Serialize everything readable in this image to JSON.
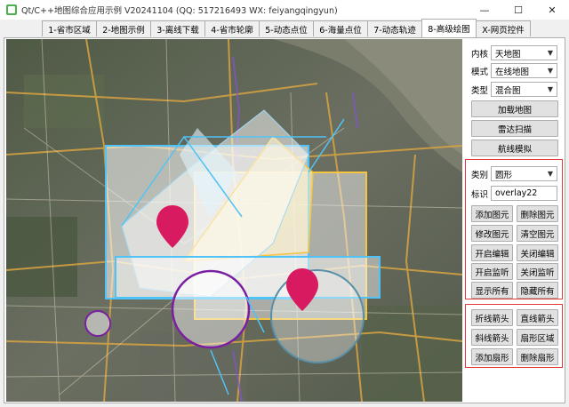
{
  "window": {
    "title": "Qt/C++地图综合应用示例 V20241104 (QQ: 517216493 WX: feiyangqingyun)",
    "minimize_icon": "minimize-icon",
    "maximize_icon": "maximize-icon",
    "close_icon": "close-icon"
  },
  "tabs": [
    {
      "label": "1-省市区域"
    },
    {
      "label": "2-地图示例"
    },
    {
      "label": "3-离线下载"
    },
    {
      "label": "4-省市轮廓"
    },
    {
      "label": "5-动态点位"
    },
    {
      "label": "6-海量点位"
    },
    {
      "label": "7-动态轨迹"
    },
    {
      "label": "8-高级绘图",
      "active": true
    },
    {
      "label": "X-网页控件"
    }
  ],
  "panel": {
    "kernel_label": "内核",
    "kernel_value": "天地图",
    "mode_label": "模式",
    "mode_value": "在线地图",
    "type_label": "类型",
    "type_value": "混合图",
    "load_map": "加载地图",
    "radar_scan": "雷达扫描",
    "route_sim": "航线模拟",
    "category_label": "类别",
    "category_value": "圆形",
    "id_label": "标识",
    "id_value": "overlay22",
    "buttons": {
      "add": "添加图元",
      "delete": "删除图元",
      "modify": "修改图元",
      "clear": "清空图元",
      "open_edit": "开启编辑",
      "close_edit": "关闭编辑",
      "open_listen": "开启监听",
      "close_listen": "关闭监听",
      "show_all": "显示所有",
      "hide_all": "隐藏所有",
      "polyline_arrow": "折线箭头",
      "straight_arrow": "直线箭头",
      "diagonal_arrow": "斜线箭头",
      "sector_area": "扇形区域",
      "add_sector": "添加扇形",
      "delete_sector": "删除扇形"
    }
  },
  "colors": {
    "accent_red": "#e53935",
    "marker": "#d81b60",
    "circle_purple": "#7b1fa2",
    "rect_blue": "#4fc3f7",
    "rect_yellow": "#f5c542"
  }
}
